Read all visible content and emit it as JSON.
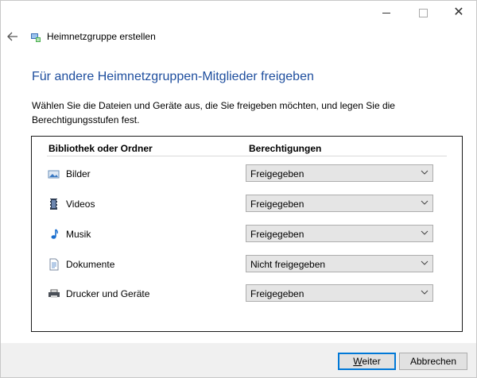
{
  "window": {
    "nav_title": "Heimnetzgruppe erstellen",
    "heading": "Für andere Heimnetzgruppen-Mitglieder freigeben",
    "description": "Wählen Sie die Dateien und Geräte aus, die Sie freigeben möchten, und legen Sie die Berechtigungsstufen fest."
  },
  "table": {
    "col_library": "Bibliothek oder Ordner",
    "col_permissions": "Berechtigungen",
    "rows": [
      {
        "label": "Bilder",
        "permission": "Freigegeben",
        "icon": "pictures-icon"
      },
      {
        "label": "Videos",
        "permission": "Freigegeben",
        "icon": "videos-icon"
      },
      {
        "label": "Musik",
        "permission": "Freigegeben",
        "icon": "music-icon"
      },
      {
        "label": "Dokumente",
        "permission": "Nicht freigegeben",
        "icon": "documents-icon"
      },
      {
        "label": "Drucker und Geräte",
        "permission": "Freigegeben",
        "icon": "printer-icon"
      }
    ]
  },
  "buttons": {
    "next": "Weiter",
    "cancel": "Abbrechen"
  },
  "colors": {
    "heading": "#1e4e9e",
    "footer_bg": "#f0f0f0",
    "focus": "#0078d7"
  }
}
